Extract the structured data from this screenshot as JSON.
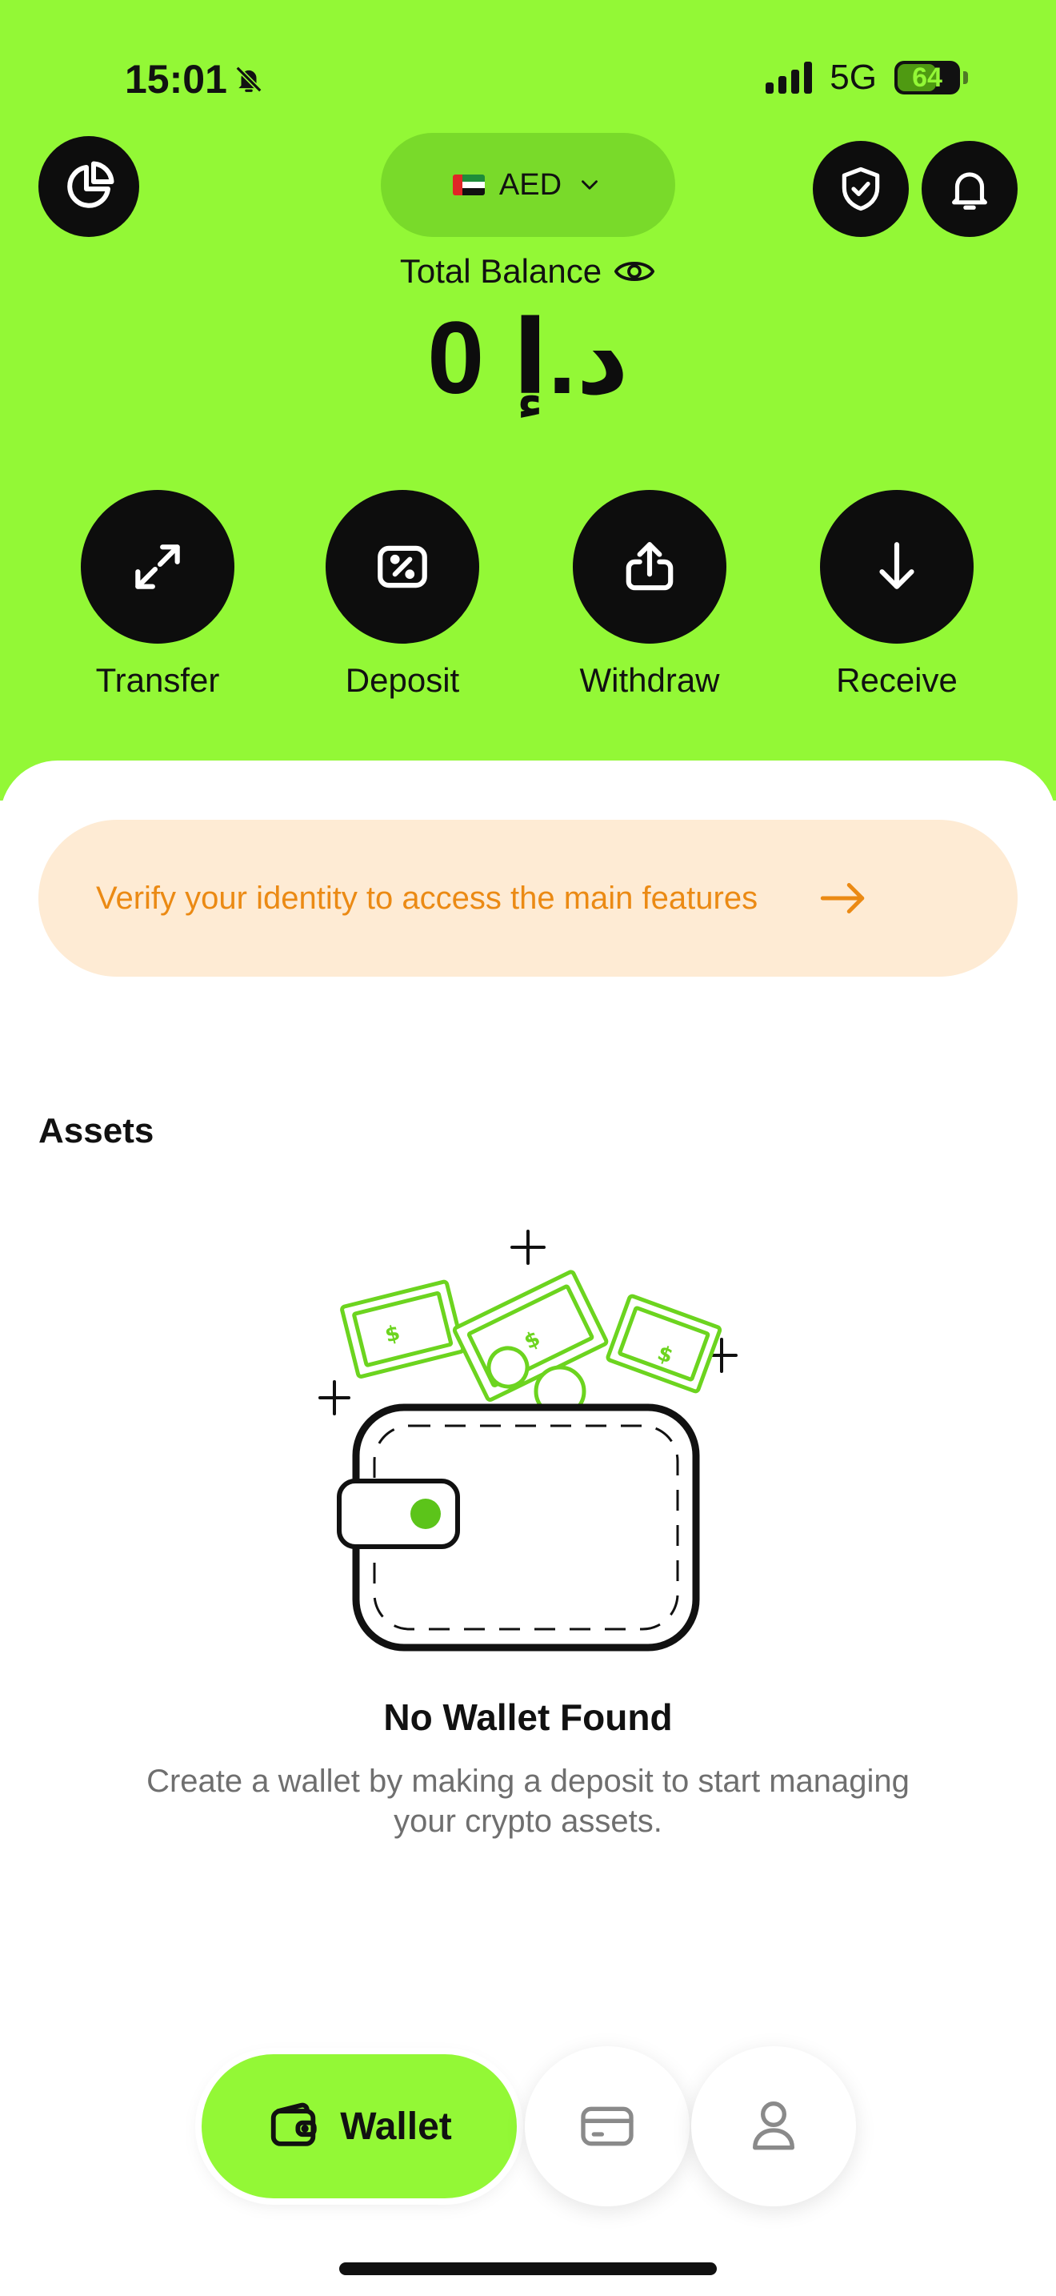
{
  "status_bar": {
    "time": "15:01",
    "network": "5G",
    "battery": "64",
    "battery_level": 0.64
  },
  "header": {
    "currency": "AED",
    "balance_label": "Total Balance",
    "balance_amount": "د.إ 0"
  },
  "actions": [
    {
      "label": "Transfer",
      "icon": "transfer-arrows-icon"
    },
    {
      "label": "Deposit",
      "icon": "percent-ticket-icon"
    },
    {
      "label": "Withdraw",
      "icon": "upload-share-icon"
    },
    {
      "label": "Receive",
      "icon": "arrow-down-icon"
    }
  ],
  "verify_banner": {
    "text": "Verify your identity to access the main features"
  },
  "assets": {
    "title": "Assets",
    "empty_title": "No Wallet Found",
    "empty_description": "Create a wallet by making a deposit to start managing your crypto assets."
  },
  "bottom_nav": {
    "wallet_label": "Wallet",
    "items": [
      "wallet-icon",
      "card-icon",
      "profile-icon"
    ]
  },
  "colors": {
    "accent": "#93f836",
    "dark": "#0d0d0d",
    "banner_bg": "#feebd4",
    "banner_text": "#eb8a14"
  }
}
